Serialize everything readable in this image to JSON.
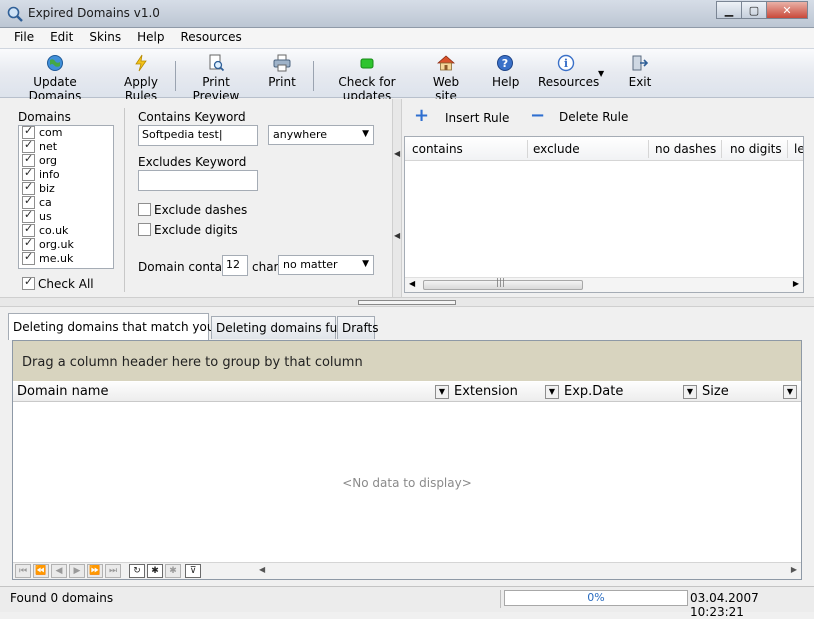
{
  "window": {
    "title": "Expired Domains v1.0"
  },
  "menu": [
    "File",
    "Edit",
    "Skins",
    "Help",
    "Resources"
  ],
  "toolbar": {
    "update": "Update Domains",
    "apply": "Apply Rules",
    "preview": "Print Preview",
    "print": "Print",
    "check": "Check for updates",
    "website": "Web site",
    "help": "Help",
    "resources": "Resources",
    "exit": "Exit"
  },
  "domains": {
    "label": "Domains",
    "items": [
      "com",
      "net",
      "org",
      "info",
      "biz",
      "ca",
      "us",
      "co.uk",
      "org.uk",
      "me.uk"
    ],
    "check_all": "Check All"
  },
  "filters": {
    "contains_label": "Contains Keyword",
    "contains_value": "Softpedia test",
    "position_select": "anywhere",
    "excludes_label": "Excludes Keyword",
    "excludes_value": "",
    "exclude_dashes": "Exclude dashes",
    "exclude_digits": "Exclude digits",
    "domain_contains_label": "Domain contains",
    "domain_contains_value": "12",
    "char_label": "char",
    "char_select": "no matter"
  },
  "rules": {
    "insert": "Insert Rule",
    "delete": "Delete Rule",
    "columns": [
      "contains",
      "exclude",
      "no dashes",
      "no digits",
      "le"
    ]
  },
  "tabs": [
    "Deleting domains that match your rules",
    "Deleting domains full list",
    "Drafts"
  ],
  "grid": {
    "group_hint": "Drag a column header here to group by that column",
    "columns": [
      "Domain name",
      "Extension",
      "Exp.Date",
      "Size"
    ],
    "empty": "<No data to display>"
  },
  "status": {
    "text": "Found 0 domains",
    "progress": "0%",
    "progress_value": 0,
    "datetime": "03.04.2007 10:23:21"
  },
  "colors": {
    "accent": "#3b8fd6",
    "groupbar": "#d8d4bf"
  }
}
